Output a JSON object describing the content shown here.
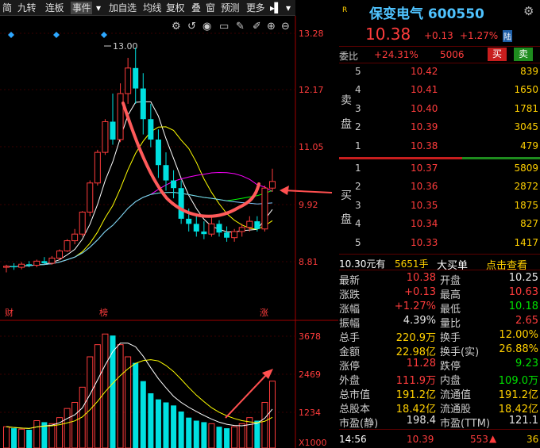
{
  "toolbar": {
    "items": [
      "简",
      "九转",
      "连板",
      "事件",
      "加自选",
      "均线",
      "复权",
      "叠",
      "窗",
      "预测",
      "更多"
    ],
    "dropdown_icon": "chevron-down-icon"
  },
  "chart": {
    "price_ticks": [
      "13.28",
      "12.17",
      "11.05",
      "9.92",
      "8.81"
    ],
    "volume_ticks": [
      "3678",
      "2469",
      "1234",
      "X1000"
    ],
    "high_label": "13.00",
    "markers": {
      "cai": "财",
      "bang": "榜",
      "zhang": "涨"
    },
    "colors": {
      "up": "#ff3c3c",
      "down": "#00e0e0",
      "ma5": "#ffffff",
      "ma10": "#ffff00",
      "ma20": "#ff00ff",
      "ma30": "#00ff00",
      "ma60": "#7fc9ff",
      "annotation": "#ff5050"
    }
  },
  "chart_data": {
    "type": "candlestick",
    "price_axis_ticks": [
      13.28,
      12.17,
      11.05,
      9.92,
      8.81
    ],
    "volume_axis_ticks": [
      3678,
      2469,
      1234
    ],
    "volume_unit": "X1000",
    "candles": [
      [
        8.7,
        8.75,
        8.6,
        8.72
      ],
      [
        8.72,
        8.78,
        8.65,
        8.7
      ],
      [
        8.7,
        8.8,
        8.66,
        8.76
      ],
      [
        8.76,
        8.82,
        8.7,
        8.74
      ],
      [
        8.74,
        8.85,
        8.7,
        8.82
      ],
      [
        8.82,
        8.9,
        8.76,
        8.78
      ],
      [
        8.78,
        8.92,
        8.75,
        8.88
      ],
      [
        8.88,
        9.05,
        8.84,
        9.02
      ],
      [
        9.02,
        9.25,
        9.0,
        9.22
      ],
      [
        9.22,
        9.45,
        9.15,
        9.35
      ],
      [
        9.35,
        9.8,
        9.3,
        9.78
      ],
      [
        9.78,
        10.4,
        9.7,
        10.35
      ],
      [
        10.35,
        11.0,
        10.3,
        10.95
      ],
      [
        10.95,
        11.6,
        10.9,
        11.55
      ],
      [
        11.55,
        12.1,
        11.1,
        11.2
      ],
      [
        11.2,
        12.3,
        11.15,
        12.1
      ],
      [
        12.1,
        12.8,
        11.9,
        12.6
      ],
      [
        12.6,
        13.0,
        11.9,
        12.2
      ],
      [
        12.2,
        12.5,
        11.3,
        11.6
      ],
      [
        11.6,
        11.9,
        11.05,
        11.2
      ],
      [
        11.2,
        11.4,
        10.45,
        10.7
      ],
      [
        10.7,
        10.95,
        10.2,
        10.4
      ],
      [
        10.4,
        10.6,
        10.05,
        10.25
      ],
      [
        10.25,
        10.4,
        9.55,
        9.65
      ],
      [
        9.65,
        9.85,
        9.4,
        9.55
      ],
      [
        9.55,
        9.7,
        9.3,
        9.4
      ],
      [
        9.4,
        9.6,
        9.25,
        9.35
      ],
      [
        9.35,
        9.7,
        9.3,
        9.55
      ],
      [
        9.55,
        9.62,
        9.3,
        9.38
      ],
      [
        9.38,
        9.5,
        9.2,
        9.28
      ],
      [
        9.28,
        9.45,
        9.2,
        9.4
      ],
      [
        9.4,
        9.55,
        9.3,
        9.48
      ],
      [
        9.48,
        9.7,
        9.4,
        9.6
      ],
      [
        9.6,
        9.7,
        9.4,
        9.45
      ],
      [
        9.45,
        10.3,
        9.4,
        10.25
      ],
      [
        10.25,
        10.63,
        10.18,
        10.38
      ]
    ],
    "volumes": [
      700,
      650,
      620,
      600,
      900,
      850,
      800,
      1000,
      1300,
      1500,
      2000,
      3000,
      3400,
      3750,
      3700,
      3400,
      3000,
      2800,
      2200,
      1800,
      1600,
      1500,
      1400,
      1200,
      1000,
      900,
      850,
      800,
      700,
      650,
      700,
      800,
      1000,
      900,
      1500,
      2200
    ]
  },
  "stock": {
    "name": "保变电气",
    "code": "600550",
    "title": "保变电气 600550",
    "price": "10.38",
    "change": "+0.13",
    "pct": "+1.27%",
    "tag": "陆",
    "r_badge": "R",
    "settings_icon": "gear-icon"
  },
  "weibi": {
    "label": "委比",
    "value": "+24.31%",
    "diff": "5006",
    "buy_btn": "买",
    "sell_btn": "卖"
  },
  "sell_side": {
    "label": "卖盘",
    "rows": [
      {
        "n": "5",
        "price": "10.42",
        "vol": "839"
      },
      {
        "n": "4",
        "price": "10.41",
        "vol": "1650"
      },
      {
        "n": "3",
        "price": "10.40",
        "vol": "1781"
      },
      {
        "n": "2",
        "price": "10.39",
        "vol": "3045"
      },
      {
        "n": "1",
        "price": "10.38",
        "vol": "479"
      }
    ]
  },
  "buy_side": {
    "label": "买盘",
    "rows": [
      {
        "n": "1",
        "price": "10.37",
        "vol": "5809"
      },
      {
        "n": "2",
        "price": "10.36",
        "vol": "2872"
      },
      {
        "n": "3",
        "price": "10.35",
        "vol": "1875"
      },
      {
        "n": "4",
        "price": "10.34",
        "vol": "827"
      },
      {
        "n": "5",
        "price": "10.33",
        "vol": "1417"
      }
    ]
  },
  "bigorder": {
    "price": "10.30元有",
    "vol": "5651手",
    "label": "大买单",
    "link": "点击查看"
  },
  "stats": [
    {
      "l1": "最新",
      "v1": "10.38",
      "c1": "red",
      "l2": "开盘",
      "v2": "10.25",
      "c2": "white"
    },
    {
      "l1": "涨跌",
      "v1": "+0.13",
      "c1": "red",
      "l2": "最高",
      "v2": "10.63",
      "c2": "red"
    },
    {
      "l1": "涨幅",
      "v1": "+1.27%",
      "c1": "red",
      "l2": "最低",
      "v2": "10.18",
      "c2": "green"
    },
    {
      "l1": "振幅",
      "v1": "4.39%",
      "c1": "white",
      "l2": "量比",
      "v2": "2.65",
      "c2": "red"
    },
    {
      "l1": "总手",
      "v1": "220.9万",
      "c1": "yellow",
      "l2": "换手",
      "v2": "12.00%",
      "c2": "yellow"
    },
    {
      "l1": "金额",
      "v1": "22.98亿",
      "c1": "yellow",
      "l2": "换手(实)",
      "v2": "26.88%",
      "c2": "yellow"
    },
    {
      "l1": "涨停",
      "v1": "11.28",
      "c1": "red",
      "l2": "跌停",
      "v2": "9.23",
      "c2": "green"
    },
    {
      "l1": "外盘",
      "v1": "111.9万",
      "c1": "red",
      "l2": "内盘",
      "v2": "109.0万",
      "c2": "green"
    },
    {
      "l1": "总市值",
      "v1": "191.2亿",
      "c1": "yellow",
      "l2": "流通值",
      "v2": "191.2亿",
      "c2": "yellow"
    },
    {
      "l1": "总股本",
      "v1": "18.42亿",
      "c1": "yellow",
      "l2": "流通股",
      "v2": "18.42亿",
      "c2": "yellow"
    },
    {
      "l1": "市盈(静)",
      "v1": "198.4",
      "c1": "white",
      "l2": "市盈(TTM)",
      "v2": "121.1",
      "c2": "white"
    }
  ],
  "tick": {
    "time": "14:56",
    "price": "10.39",
    "vol": "553",
    "num": "36"
  }
}
